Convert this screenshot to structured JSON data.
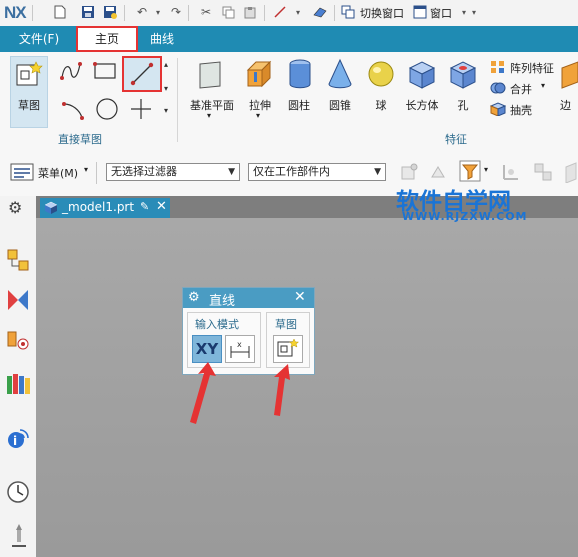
{
  "app": {
    "logo": "NX"
  },
  "quick_access": {
    "switch_window_label": "切换窗口",
    "window_menu_label": "窗口"
  },
  "tabs": [
    {
      "label": "文件(F)"
    },
    {
      "label": "主页"
    },
    {
      "label": "曲线"
    }
  ],
  "ribbon": {
    "sketch_label": "草图",
    "direct_sketch_group": "直接草图",
    "feature_group": "特征",
    "features": [
      {
        "label": "基准平面"
      },
      {
        "label": "拉伸"
      },
      {
        "label": "圆柱"
      },
      {
        "label": "圆锥"
      },
      {
        "label": "球"
      },
      {
        "label": "长方体"
      },
      {
        "label": "孔"
      }
    ],
    "pattern_feature_label": "阵列特征",
    "unite_label": "合并",
    "shell_label": "抽壳",
    "edge_label": "边"
  },
  "filterbar": {
    "menu_label": "菜单(M)",
    "type_filter_value": "无选择过滤器",
    "scope_value": "仅在工作部件内"
  },
  "document": {
    "tab_name": "_model1.prt"
  },
  "dialog": {
    "title": "直线",
    "input_mode_label": "输入模式",
    "xy_label": "XY",
    "sketch_label": "草图"
  },
  "watermark": {
    "text": "软件自学网",
    "url": "WWW.RJZXW.COM"
  },
  "colors": {
    "accent": "#1f8bb3",
    "highlight": "#e53333",
    "watermark": "#1a74d6"
  }
}
